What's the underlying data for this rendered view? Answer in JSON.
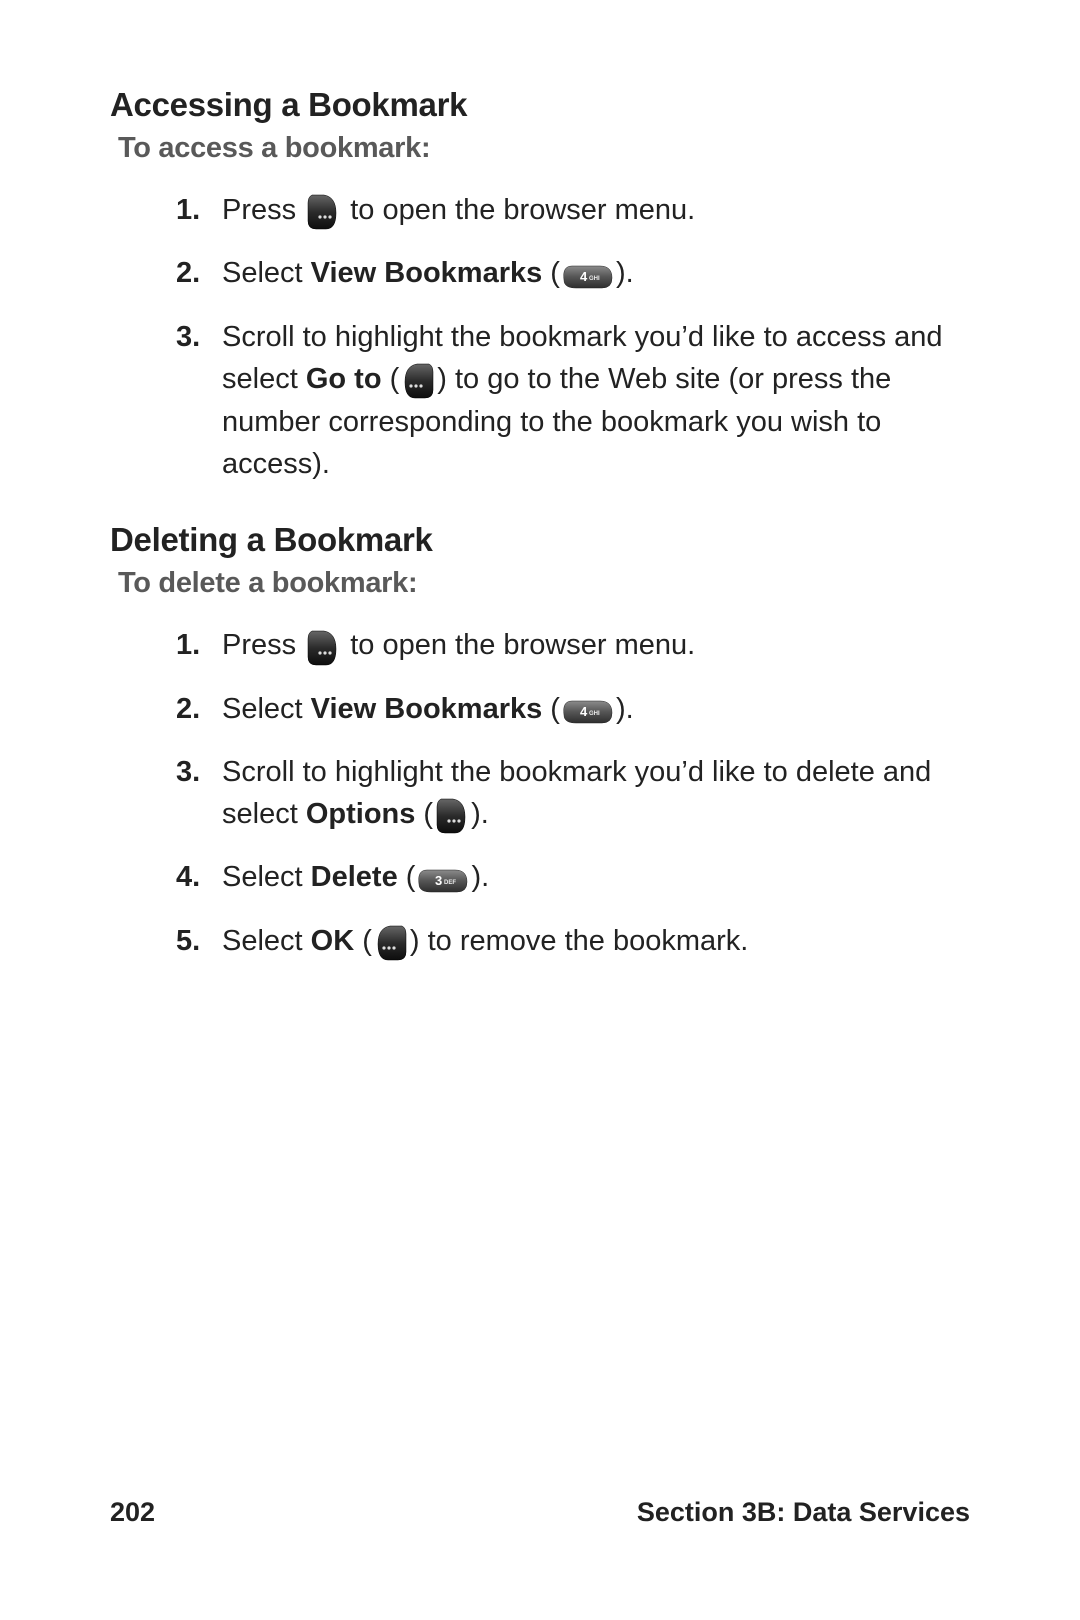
{
  "section_a": {
    "heading": "Accessing a Bookmark",
    "sub": "To access a bookmark:",
    "steps": [
      {
        "num": "1.",
        "parts": [
          "Press ",
          {
            "icon": "softkey-right"
          },
          " to open the browser menu."
        ]
      },
      {
        "num": "2.",
        "parts": [
          "Select ",
          {
            "b": "View Bookmarks"
          },
          " (",
          {
            "icon": "key-4ghi"
          },
          ")."
        ]
      },
      {
        "num": "3.",
        "parts": [
          "Scroll to highlight the bookmark you’d like to access and select ",
          {
            "b": "Go to"
          },
          " (",
          {
            "icon": "softkey-left"
          },
          ") to go to the Web site (or press the number corresponding to the bookmark you wish to access)."
        ]
      }
    ]
  },
  "section_b": {
    "heading": "Deleting a Bookmark",
    "sub": "To delete a bookmark:",
    "steps": [
      {
        "num": "1.",
        "parts": [
          "Press ",
          {
            "icon": "softkey-right"
          },
          " to open the browser menu."
        ]
      },
      {
        "num": "2.",
        "parts": [
          "Select ",
          {
            "b": "View Bookmarks"
          },
          " (",
          {
            "icon": "key-4ghi"
          },
          ")."
        ]
      },
      {
        "num": "3.",
        "parts": [
          "Scroll to highlight the bookmark you’d like to delete and select ",
          {
            "b": "Options"
          },
          " (",
          {
            "icon": "softkey-right"
          },
          ")."
        ]
      },
      {
        "num": "4.",
        "parts": [
          "Select ",
          {
            "b": "Delete"
          },
          " (",
          {
            "icon": "key-3def"
          },
          ")."
        ]
      },
      {
        "num": "5.",
        "parts": [
          "Select ",
          {
            "b": "OK"
          },
          " (",
          {
            "icon": "softkey-left"
          },
          ") to remove the bookmark."
        ]
      }
    ]
  },
  "footer": {
    "page": "202",
    "section": "Section 3B: Data Services"
  },
  "icons": {
    "key-4ghi": "4 GHI",
    "key-3def": "3 DEF"
  }
}
